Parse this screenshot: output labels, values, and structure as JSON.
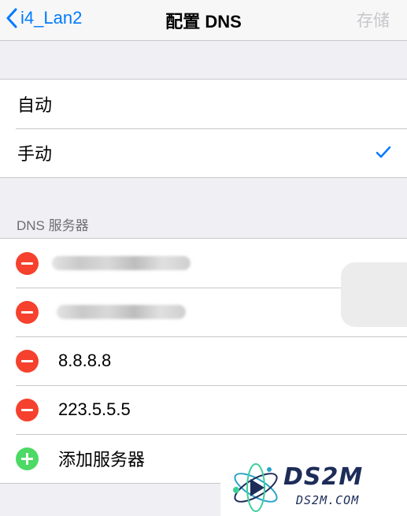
{
  "navbar": {
    "back_label": "i4_Lan2",
    "title": "配置 DNS",
    "save_label": "存储"
  },
  "mode": {
    "options": [
      "自动",
      "手动"
    ],
    "selected": "手动"
  },
  "dns": {
    "header": "DNS 服务器",
    "servers": [
      "8.8.8.8",
      "223.5.5.5"
    ],
    "add_label": "添加服务器"
  },
  "watermark": {
    "title": "DS2M",
    "subtitle": "DS2M.COM"
  },
  "colors": {
    "accent": "#007aff",
    "delete": "#f5412d",
    "add": "#4cd964"
  }
}
